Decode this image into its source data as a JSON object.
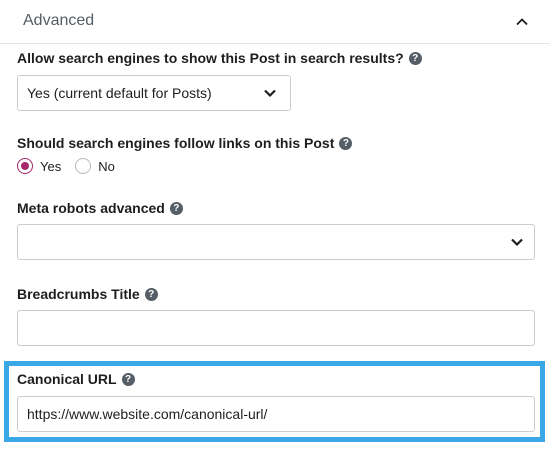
{
  "panel": {
    "title": "Advanced",
    "collapse_icon": "chevron-up-icon"
  },
  "search_results": {
    "label": "Allow search engines to show this Post in search results?",
    "selected": "Yes (current default for Posts)"
  },
  "follow_links": {
    "label": "Should search engines follow links on this Post",
    "options": [
      "Yes",
      "No"
    ],
    "selected": "Yes"
  },
  "meta_robots": {
    "label": "Meta robots advanced",
    "selected": ""
  },
  "breadcrumbs_title": {
    "label": "Breadcrumbs Title",
    "value": ""
  },
  "canonical_url": {
    "label": "Canonical URL",
    "value": "https://www.website.com/canonical-url/"
  },
  "help_icon": "?",
  "colors": {
    "accent": "#a4286a",
    "highlight": "#3aa7e6"
  }
}
